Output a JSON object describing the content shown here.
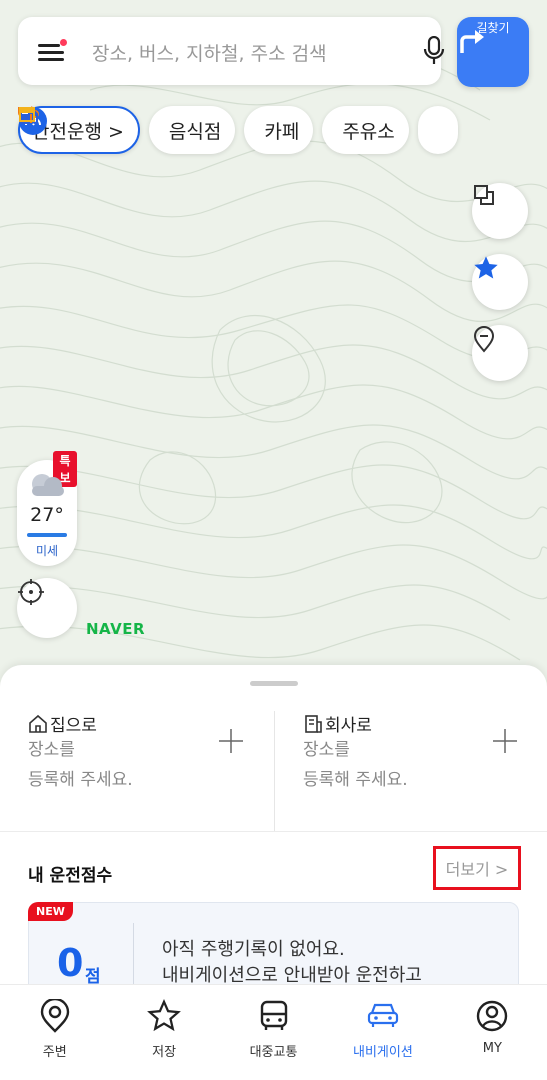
{
  "search": {
    "placeholder": "장소, 버스, 지하철, 주소 검색",
    "route_label": "길찾기"
  },
  "chips": [
    {
      "label": "안전운행 >",
      "icon": "speedometer-icon"
    },
    {
      "label": "음식점",
      "icon": "fork-knife-icon"
    },
    {
      "label": "카페",
      "icon": "coffee-cup-icon"
    },
    {
      "label": "주유소",
      "icon": "fuel-pump-icon"
    }
  ],
  "map_controls": {
    "layers": "layers-icon",
    "favorites": "star-icon",
    "pin": "location-pin-icon"
  },
  "weather": {
    "alert": "특보",
    "temperature": "27°",
    "dust": "미세"
  },
  "brand": "NAVER",
  "places": {
    "home": {
      "title": "집으로",
      "line1": "장소를",
      "line2": "등록해 주세요."
    },
    "work": {
      "title": "회사로",
      "line1": "장소를",
      "line2": "등록해 주세요."
    }
  },
  "driving_score": {
    "title": "내 운전점수",
    "more": "더보기 >",
    "badge": "NEW",
    "score": "0",
    "unit": "점",
    "message_line1": "아직 주행기록이 없어요.",
    "message_line2": "내비게이션으로 안내받아 운전하고"
  },
  "tabs": [
    {
      "label": "주변",
      "icon": "nearby-pin-icon"
    },
    {
      "label": "저장",
      "icon": "star-outline-icon"
    },
    {
      "label": "대중교통",
      "icon": "bus-icon"
    },
    {
      "label": "내비게이션",
      "icon": "car-icon"
    },
    {
      "label": "MY",
      "icon": "profile-icon"
    }
  ],
  "colors": {
    "accent": "#3b7cf5",
    "alert": "#e8101e",
    "naver": "#15b548"
  }
}
